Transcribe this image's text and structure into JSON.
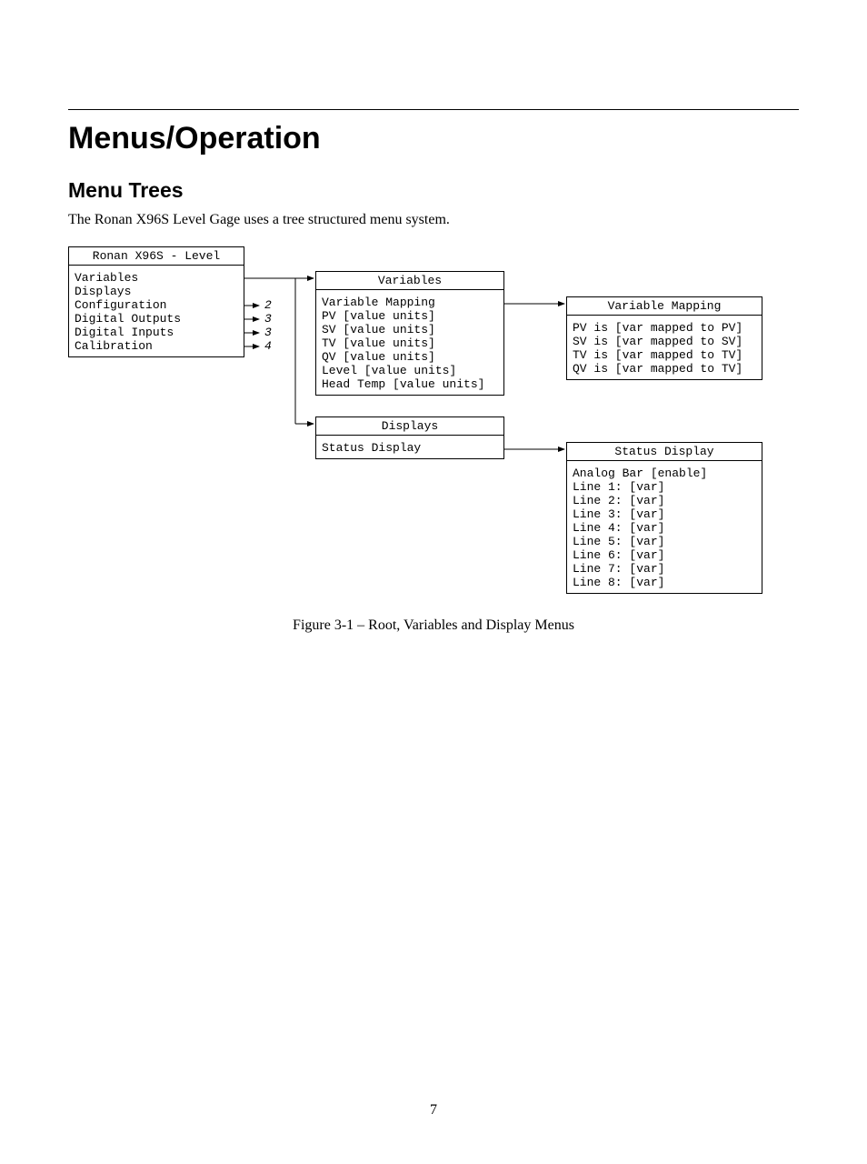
{
  "chapter_title": "Menus/Operation",
  "section_title": "Menu Trees",
  "intro_text": "The Ronan X96S Level Gage uses a tree structured menu system.",
  "root_box": {
    "title": "Ronan X96S - Level",
    "items": [
      "Variables",
      "Displays",
      "Configuration",
      "Digital Outputs",
      "Digital Inputs",
      "Calibration"
    ],
    "annotations": [
      "2",
      "3",
      "3",
      "4"
    ]
  },
  "variables_box": {
    "title": "Variables",
    "items": [
      "Variable Mapping",
      "PV [value units]",
      "SV [value units]",
      "TV [value units]",
      "QV [value units]",
      "Level [value units]",
      "Head Temp [value units]"
    ]
  },
  "var_mapping_box": {
    "title": "Variable Mapping",
    "items": [
      "PV is [var mapped to PV]",
      "SV is [var mapped to SV]",
      "TV is [var mapped to TV]",
      "QV is [var mapped to TV]"
    ]
  },
  "displays_box": {
    "title": "Displays",
    "items": [
      "Status Display"
    ]
  },
  "status_display_box": {
    "title": "Status Display",
    "items": [
      "Analog Bar [enable]",
      "Line 1: [var]",
      "Line 2: [var]",
      "Line 3: [var]",
      "Line 4: [var]",
      "Line 5: [var]",
      "Line 6: [var]",
      "Line 7: [var]",
      "Line 8: [var]"
    ]
  },
  "figure_caption": "Figure 3-1 – Root, Variables and Display Menus",
  "page_number": "7"
}
